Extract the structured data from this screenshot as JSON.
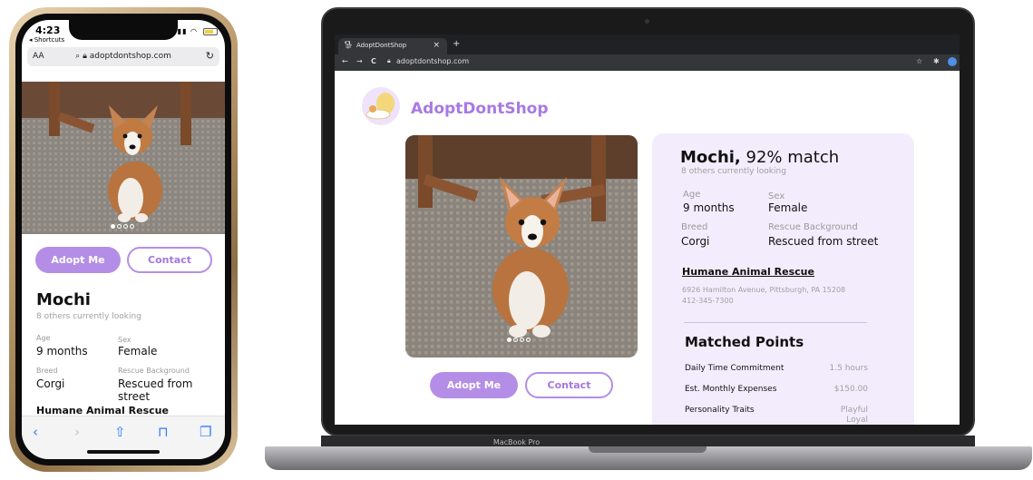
{
  "phone": {
    "status_time": "4:23",
    "status_back": "◂ Shortcuts",
    "url_aa": "AA",
    "url": "adoptdontshop.com",
    "carousel_dots": 4,
    "carousel_active": 1,
    "adopt_label": "Adopt Me",
    "contact_label": "Contact",
    "name": "Mochi",
    "looking": "8 others currently looking",
    "age_label": "Age",
    "age_value": "9 months",
    "sex_label": "Sex",
    "sex_value": "Female",
    "breed_label": "Breed",
    "breed_value": "Corgi",
    "rescue_label": "Rescue Background",
    "rescue_value": "Rescued from street",
    "shelter_partial": "Humane Animal Rescue"
  },
  "browser": {
    "tab_title": "AdoptDontShop",
    "tab_close": "×",
    "new_tab": "+",
    "url": "adoptdontshop.com",
    "nav_back": "←",
    "nav_forward": "→",
    "nav_reload": "C"
  },
  "site": {
    "brand": "AdoptDontShop",
    "adopt_label": "Adopt Me",
    "contact_label": "Contact",
    "carousel_dots": 4,
    "carousel_active": 1
  },
  "pet": {
    "name": "Mochi,",
    "match": "92% match",
    "looking": "8 others currently looking",
    "age_label": "Age",
    "age_value": "9 months",
    "sex_label": "Sex",
    "sex_value": "Female",
    "breed_label": "Breed",
    "breed_value": "Corgi",
    "rescue_label": "Rescue Background",
    "rescue_value": "Rescued from street"
  },
  "shelter": {
    "name": "Humane Animal Rescue",
    "address": "6926 Hamilton Avenue, Pittsburgh, PA 15208",
    "phone": "412-345-7300"
  },
  "matched": {
    "heading": "Matched Points",
    "rows": [
      {
        "label": "Daily Time Commitment",
        "value": "1.5 hours"
      },
      {
        "label": "Est. Monthly Expenses",
        "value": "$150.00"
      },
      {
        "label": "Personality Traits",
        "value": "Playful",
        "value2": "Loyal"
      }
    ]
  },
  "device_label": "MacBook Pro",
  "colors": {
    "accent": "#b48ee6",
    "brand": "#a879e3",
    "card_bg": "#f3ecfd"
  }
}
